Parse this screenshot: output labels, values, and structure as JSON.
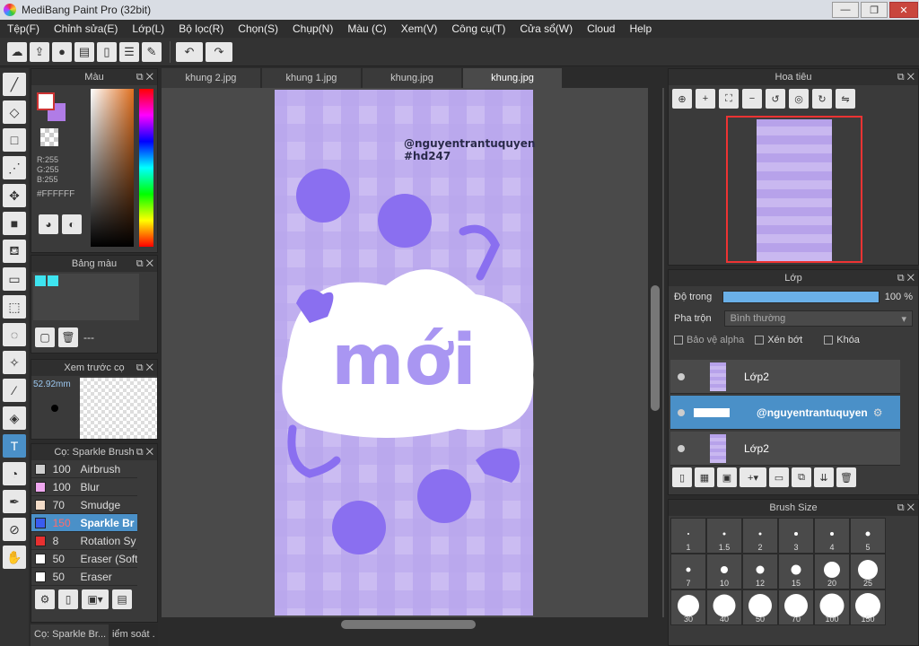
{
  "app": {
    "title": "MediBang Paint Pro (32bit)"
  },
  "window_controls": {
    "minimize": "—",
    "restore": "❐",
    "close": "✕"
  },
  "menu": [
    "Tệp(F)",
    "Chỉnh sửa(E)",
    "Lớp(L)",
    "Bộ lọc(R)",
    "Chọn(S)",
    "Chụp(N)",
    "Màu (C)",
    "Xem(V)",
    "Công cụ(T)",
    "Cửa sổ(W)",
    "Cloud",
    "Help"
  ],
  "toolbar_icons": [
    "cloud-icon",
    "upload-icon",
    "comment-icon",
    "chat-icon",
    "page-icon",
    "page-list-icon",
    "page-edit-icon",
    "undo-icon",
    "redo-icon"
  ],
  "tools": [
    "brush-icon",
    "eraser-icon",
    "rectangle-icon",
    "dot-icon",
    "move-icon",
    "fill-rect-icon",
    "bucket-icon",
    "gradient-icon",
    "select-rect-icon",
    "lasso-icon",
    "magic-wand-icon",
    "select-pen-icon",
    "select-eraser-icon",
    "text-icon",
    "select-fill-icon",
    "pen-icon",
    "eyedropper-icon",
    "hand-icon"
  ],
  "color_panel": {
    "title": "Màu",
    "rgb": [
      "R:255",
      "G:255",
      "B:255"
    ],
    "hex": "#FFFFFF"
  },
  "palette_panel": {
    "title": "Bảng màu",
    "value": "---"
  },
  "preview_panel": {
    "title": "Xem trước cọ",
    "size": "52.92mm"
  },
  "brush_panel": {
    "title": "Cọ: Sparkle Brush",
    "brushes": [
      {
        "size": "100",
        "name": "Airbrush",
        "color": "#cfcfcf"
      },
      {
        "size": "100",
        "name": "Blur",
        "color": "#f0a8f0"
      },
      {
        "size": "70",
        "name": "Smudge",
        "color": "#f3dcc8"
      },
      {
        "size": "150",
        "name": "Sparkle Br",
        "color": "#3a5cf0"
      },
      {
        "size": "8",
        "name": "Rotation Sy",
        "color": "#e83030"
      },
      {
        "size": "50",
        "name": "Eraser (Soft",
        "color": "#ffffff"
      },
      {
        "size": "50",
        "name": "Eraser",
        "color": "#ffffff"
      }
    ],
    "selected_index": 3
  },
  "bottom_tabs": [
    "Cọ: Sparkle Br...",
    "iểm soát ."
  ],
  "doc_tabs": [
    "khung 2.jpg",
    "khung 1.jpg",
    "khung.jpg",
    "khung.jpg"
  ],
  "active_doc_tab": 3,
  "artwork": {
    "watermark_line1": "@nguyentrantuquyen",
    "watermark_line2": "#hd247",
    "title_text": "mới"
  },
  "navigator": {
    "title": "Hoa tiêu"
  },
  "layers_panel": {
    "title": "Lớp",
    "opacity_label": "Độ trong",
    "opacity_value": "100 %",
    "opacity_fraction": 1.0,
    "blend_label": "Pha trộn",
    "blend_value": "Bình thường",
    "protect_alpha": "Bảo vệ alpha",
    "clipping": "Xén bớt",
    "lock": "Khóa",
    "layers": [
      {
        "name": "Lớp2",
        "selected": false
      },
      {
        "name": "@nguyentrantuquyen",
        "selected": true
      },
      {
        "name": "Lớp2",
        "selected": false
      }
    ]
  },
  "brush_size_panel": {
    "title": "Brush Size",
    "sizes": [
      "1",
      "1.5",
      "2",
      "3",
      "4",
      "5",
      "7",
      "10",
      "12",
      "15",
      "20",
      "25",
      "30",
      "40",
      "50",
      "70",
      "100",
      "150"
    ]
  }
}
